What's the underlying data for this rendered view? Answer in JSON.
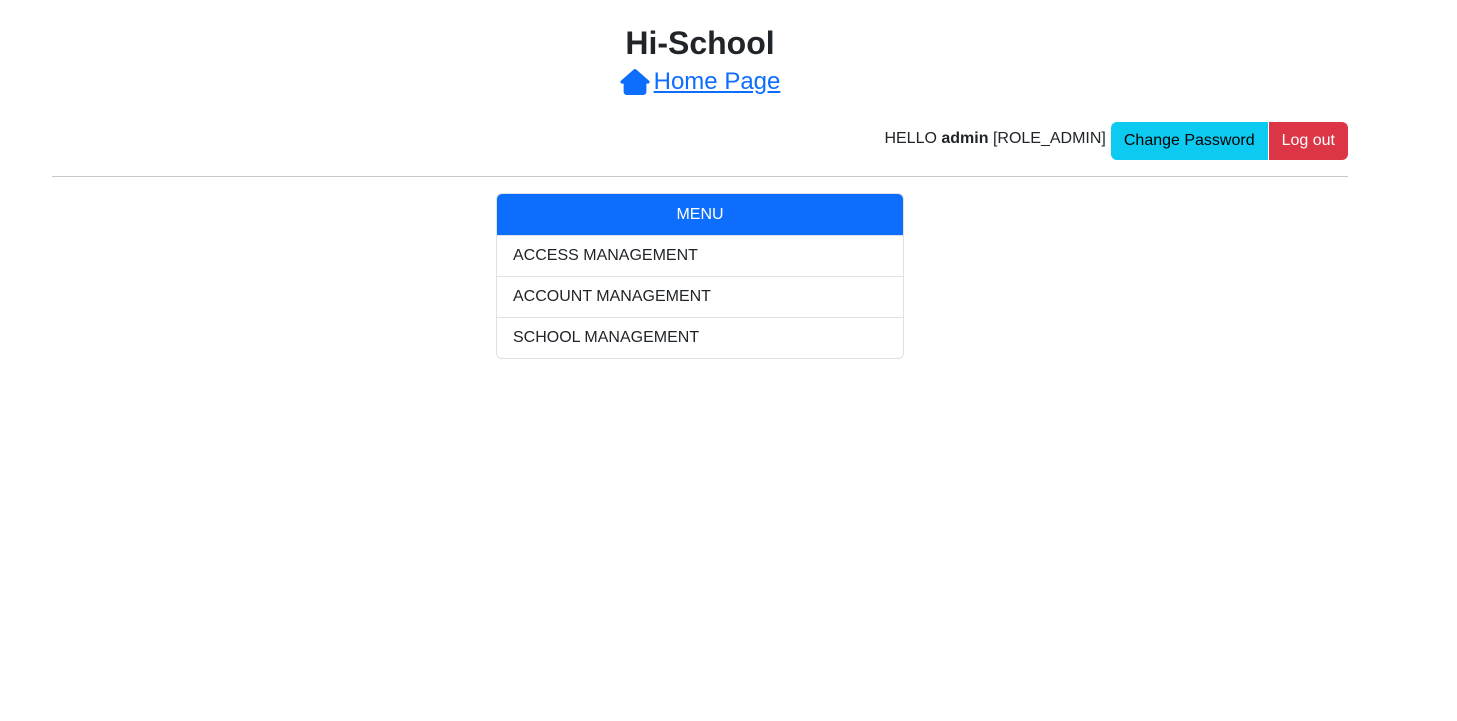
{
  "app": {
    "title": "Hi-School",
    "home_link": "Home Page"
  },
  "user": {
    "greeting": "HELLO",
    "username": "admin",
    "role": "[ROLE_ADMIN]"
  },
  "actions": {
    "change_password": "Change Password",
    "logout": "Log out"
  },
  "menu": {
    "header": "MENU",
    "items": [
      {
        "label": "ACCESS MANAGEMENT"
      },
      {
        "label": "ACCOUNT MANAGEMENT"
      },
      {
        "label": "SCHOOL MANAGEMENT"
      }
    ]
  },
  "colors": {
    "primary": "#0d6efd",
    "info": "#0dcaf0",
    "danger": "#dc3545"
  },
  "icons": {
    "home": "home-icon"
  }
}
